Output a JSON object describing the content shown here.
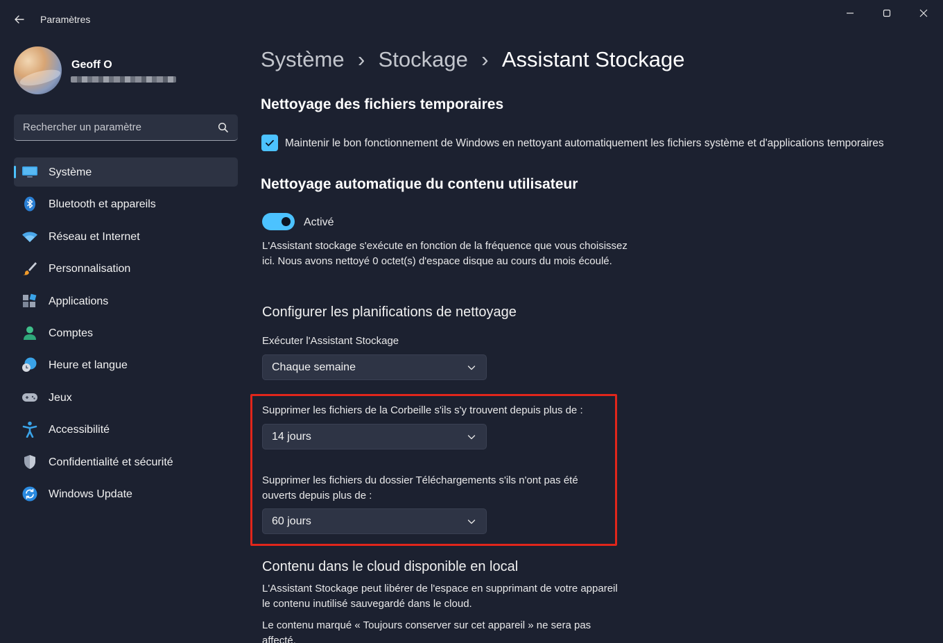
{
  "window": {
    "title": "Paramètres"
  },
  "profile": {
    "name": "Geoff O"
  },
  "search": {
    "placeholder": "Rechercher un paramètre"
  },
  "sidebar": {
    "items": [
      {
        "label": "Système",
        "icon": "monitor-icon",
        "active": true
      },
      {
        "label": "Bluetooth et appareils",
        "icon": "bluetooth-icon"
      },
      {
        "label": "Réseau et Internet",
        "icon": "wifi-icon"
      },
      {
        "label": "Personnalisation",
        "icon": "brush-icon"
      },
      {
        "label": "Applications",
        "icon": "apps-icon"
      },
      {
        "label": "Comptes",
        "icon": "person-icon"
      },
      {
        "label": "Heure et langue",
        "icon": "clock-globe-icon"
      },
      {
        "label": "Jeux",
        "icon": "gamepad-icon"
      },
      {
        "label": "Accessibilité",
        "icon": "accessibility-icon"
      },
      {
        "label": "Confidentialité et sécurité",
        "icon": "shield-icon"
      },
      {
        "label": "Windows Update",
        "icon": "update-icon"
      }
    ]
  },
  "breadcrumb": {
    "items": [
      "Système",
      "Stockage"
    ],
    "current": "Assistant Stockage",
    "separator": "›"
  },
  "main": {
    "temp_section_title": "Nettoyage des fichiers temporaires",
    "temp_checkbox_label": "Maintenir le bon fonctionnement de Windows en nettoyant automatiquement les fichiers système et d'applications temporaires",
    "auto_section_title": "Nettoyage automatique du contenu utilisateur",
    "toggle_label": "Activé",
    "auto_description": "L'Assistant stockage s'exécute en fonction de la fréquence que vous choisissez ici. Nous avons nettoyé 0 octet(s) d'espace disque au cours du mois écoulé.",
    "schedule_title": "Configurer les planifications de nettoyage",
    "run_label": "Exécuter l'Assistant Stockage",
    "run_value": "Chaque semaine",
    "recycle_label": "Supprimer les fichiers de la Corbeille s'ils s'y trouvent depuis plus de :",
    "recycle_value": "14 jours",
    "downloads_label": "Supprimer les fichiers du dossier Téléchargements s'ils n'ont pas été ouverts depuis plus de :",
    "downloads_value": "60 jours",
    "cloud_title": "Contenu dans le cloud disponible en local",
    "cloud_description": "L'Assistant Stockage peut libérer de l'espace en supprimant de votre appareil le contenu inutilisé sauvegardé dans le cloud.",
    "cloud_note": "Le contenu marqué « Toujours conserver sur cet appareil » ne sera pas affecté."
  },
  "colors": {
    "accent": "#4cc2ff",
    "highlight": "#e0261b",
    "background": "#1c2130"
  }
}
